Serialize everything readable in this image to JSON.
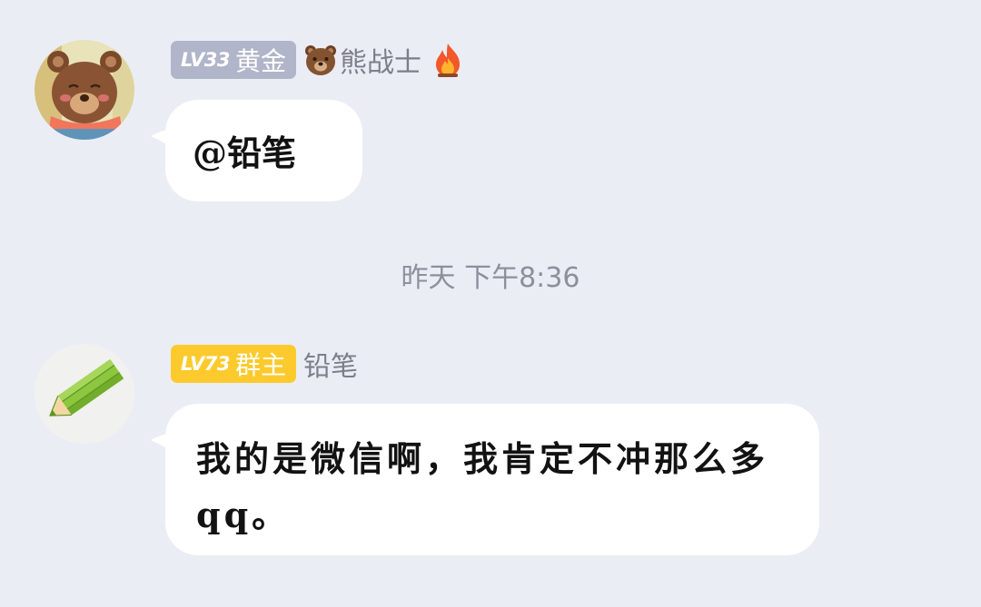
{
  "messages": [
    {
      "avatar_icon": "bear-avatar",
      "badge": {
        "level": "LV33",
        "title": "黄金",
        "color": "#b0b5c9"
      },
      "sender_icon": "bear-face-icon",
      "sender_name": "熊战士",
      "trailing_icon": "fire-icon",
      "text": "@铅笔"
    },
    {
      "avatar_icon": "pencil-avatar",
      "badge": {
        "level": "LV73",
        "title": "群主",
        "color": "#fcca2c"
      },
      "sender_name": "铅笔",
      "text": "我的是微信啊，我肯定不冲那么多qq。"
    }
  ],
  "timestamp": "昨天 下午8:36",
  "colors": {
    "background": "#ebedf5",
    "bubble": "#ffffff",
    "name_text": "#7c7f88",
    "timestamp_text": "#8c909a"
  }
}
